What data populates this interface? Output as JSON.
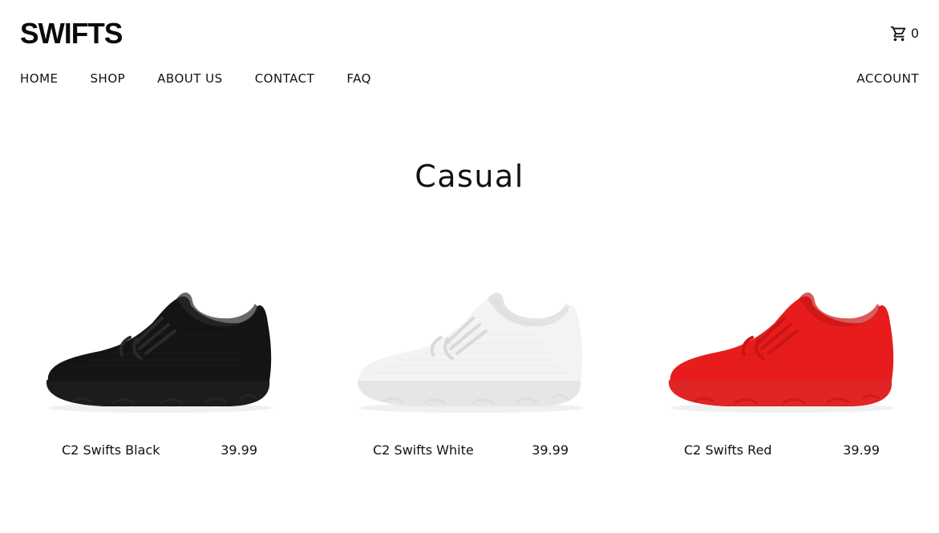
{
  "header": {
    "logo": "SWIFTS",
    "cart_count": "0",
    "cart_icon": "cart-icon"
  },
  "nav": {
    "items": [
      {
        "label": "HOME"
      },
      {
        "label": "SHOP"
      },
      {
        "label": "ABOUT US"
      },
      {
        "label": "CONTACT"
      },
      {
        "label": "FAQ"
      }
    ],
    "account": "ACCOUNT"
  },
  "page": {
    "title": "Casual"
  },
  "products": [
    {
      "name": "C2 Swifts Black",
      "price": "39.99",
      "color": "#141414",
      "sole": "#1c1c1c",
      "accent": "#2a2a2a"
    },
    {
      "name": "C2 Swifts White",
      "price": "39.99",
      "color": "#f3f3f3",
      "sole": "#e6e6e6",
      "accent": "#d9d9d9"
    },
    {
      "name": "C2 Swifts Red",
      "price": "39.99",
      "color": "#e81c1c",
      "sole": "#e02525",
      "accent": "#c91515"
    }
  ]
}
